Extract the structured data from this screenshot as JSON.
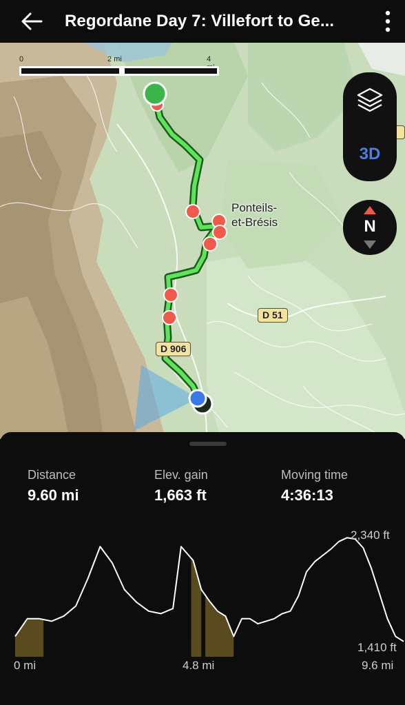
{
  "header": {
    "title": "Regordane Day 7:  Villefort to Ge...",
    "back_icon": "arrow-left-icon",
    "more_icon": "more-vertical-icon"
  },
  "map": {
    "scale": {
      "labels": [
        "0",
        "2 mi",
        "4 mi"
      ]
    },
    "town_label_line1": "Ponteils-",
    "town_label_line2": "et-Brésis",
    "roads": [
      "D 906",
      "D 51"
    ],
    "controls": {
      "layers_icon": "layers-icon",
      "mode_3d_label": "3D",
      "compass_label": "N"
    },
    "colors": {
      "route": "#3ecf3e",
      "start_marker": "#3bb54a",
      "poi": "#ef5a4c",
      "current_location": "#3a78e8"
    }
  },
  "stats": {
    "distance_label": "Distance",
    "distance_value": "9.60 mi",
    "elev_gain_label": "Elev. gain",
    "elev_gain_value": "1,663 ft",
    "moving_time_label": "Moving time",
    "moving_time_value": "4:36:13"
  },
  "chart_data": {
    "type": "line",
    "title": "",
    "xlabel": "",
    "ylabel": "",
    "x_tick_labels": [
      "0 mi",
      "4.8 mi",
      "9.6 mi"
    ],
    "y_tick_labels": [
      "2,340 ft",
      "1,410 ft"
    ],
    "xlim": [
      0,
      9.6
    ],
    "ylim": [
      1410,
      2340
    ],
    "series": [
      {
        "x": [
          0,
          0.3,
          0.6,
          0.9,
          1.2,
          1.5,
          1.8,
          2.1,
          2.4,
          2.7,
          3.0,
          3.3,
          3.6,
          3.9,
          4.1,
          4.4,
          4.6,
          4.8,
          5.0,
          5.2,
          5.4,
          5.6,
          5.8,
          6.0,
          6.2,
          6.4,
          6.6,
          6.8,
          7.0,
          7.2,
          7.4,
          7.6,
          7.8,
          8.0,
          8.2,
          8.4,
          8.6,
          8.8,
          9.0,
          9.2,
          9.4,
          9.6
        ],
        "values": [
          1560,
          1700,
          1700,
          1680,
          1720,
          1800,
          2020,
          2270,
          2140,
          1930,
          1830,
          1760,
          1740,
          1780,
          2270,
          2160,
          1930,
          1840,
          1760,
          1720,
          1560,
          1700,
          1700,
          1660,
          1680,
          1700,
          1740,
          1760,
          1880,
          2070,
          2150,
          2200,
          2250,
          2310,
          2340,
          2330,
          2260,
          2100,
          1900,
          1700,
          1560,
          1520
        ]
      }
    ],
    "shaded_segments_mi": [
      [
        0,
        0.7
      ],
      [
        4.35,
        4.6
      ],
      [
        4.7,
        5.4
      ]
    ]
  }
}
